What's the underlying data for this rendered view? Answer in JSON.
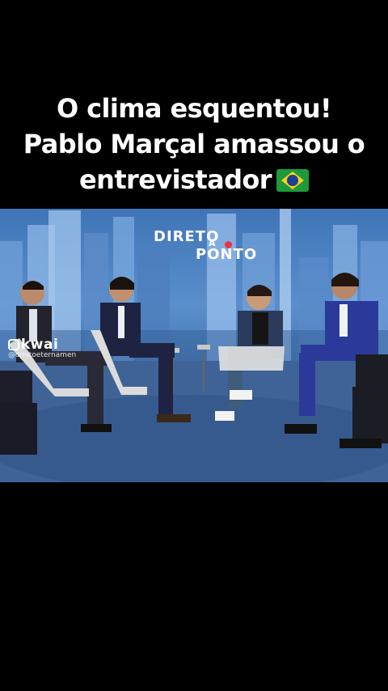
{
  "caption": {
    "lines": [
      "O clima esquentou!",
      "Pablo Marçal amassou o",
      "entrevistador"
    ],
    "emoji": "brazil-flag"
  },
  "video": {
    "logo": {
      "line1": "DIRETO",
      "connector": "A",
      "line2": "PONTO"
    },
    "watermark": {
      "brand": "kwai",
      "handle": "@omitoeternamen"
    }
  },
  "colors": {
    "background": "#000000",
    "caption_text": "#ffffff",
    "logo_accent": "#e8334a"
  }
}
